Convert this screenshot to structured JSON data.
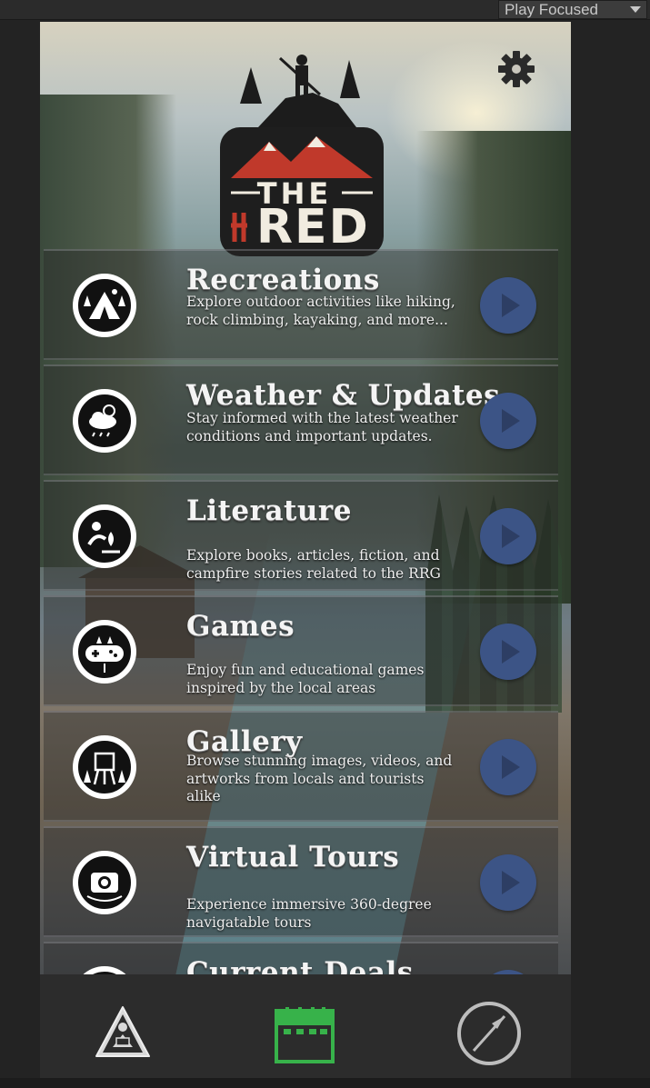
{
  "editor": {
    "play_mode": "Play Focused"
  },
  "app": {
    "logo": {
      "line1": "THE",
      "line2": "RED"
    },
    "settings_icon": "gear-icon"
  },
  "menu": {
    "items": [
      {
        "title": "Recreations",
        "description": "Explore outdoor activities like hiking, rock climbing, kayaking, and more...",
        "icon": "camping-tent-icon"
      },
      {
        "title": "Weather & Updates",
        "description": "Stay informed with the latest weather conditions and important updates.",
        "icon": "weather-cloud-icon"
      },
      {
        "title": "Literature",
        "description": "Explore books, articles, fiction, and campfire stories related to the RRG",
        "icon": "campfire-reader-icon"
      },
      {
        "title": "Games",
        "description": "Enjoy fun and educational games inspired by the local areas",
        "icon": "gamepad-icon"
      },
      {
        "title": "Gallery",
        "description": "Browse stunning images, videos, and artworks from locals and tourists alike",
        "icon": "easel-icon"
      },
      {
        "title": "Virtual Tours",
        "description": "Experience immersive 360-degree navigatable tours",
        "icon": "camera-360-icon"
      },
      {
        "title": "Current Deals",
        "description": "",
        "icon": "deals-icon"
      }
    ]
  },
  "bottom_nav": {
    "items": [
      {
        "name": "guide",
        "icon": "reader-sign-icon"
      },
      {
        "name": "calendar",
        "icon": "calendar-icon",
        "active_color": "#37b24a"
      },
      {
        "name": "compass",
        "icon": "compass-icon"
      }
    ]
  },
  "colors": {
    "go_button": "#3c5486",
    "calendar_active": "#37b24a",
    "logo_red": "#c0392b"
  }
}
